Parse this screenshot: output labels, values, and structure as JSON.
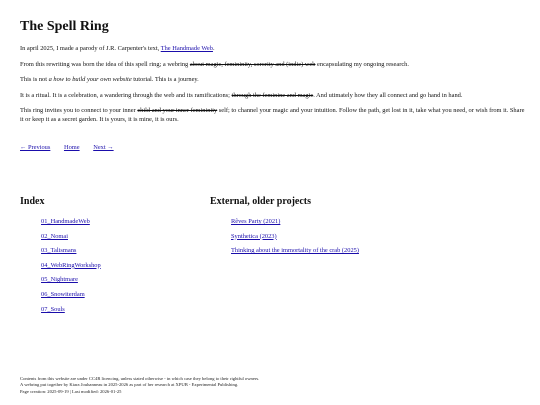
{
  "page": {
    "title": "The Spell Ring"
  },
  "intro": {
    "p1_text": "In april 2025, I made a parody of J.R. Carpenter's text, ",
    "p1_link": "The Handmade Web",
    "p1_end": ".",
    "p2_text": "From this rewriting was born the idea of this spell ring; a webring ",
    "p2_strike": "about magic, femininity, sorority and (indie) web",
    "p2_end": " encapsulating my ongoing research.",
    "p3_text": "This is not ",
    "p3_italic": "a how to build your own website",
    "p3_end": " tutorial. This is a journey.",
    "p4_text": "It is a ritual. It is a celebration, a wandering through the web and its ramifications; ",
    "p4_strike": "through the feminine and magic",
    "p4_end": ". And utimately how they all connect and go hand in hand.",
    "p5_text": "This ring invites you to connect to your inner ",
    "p5_strike": "child and your inner femininity",
    "p5_end": " self; to channel your magic and your intuition. Follow the path, get lost in it, take what you need, or wish from it. Share it or keep it as a secret garden. It is yours, it is mine, it is ours."
  },
  "nav": {
    "previous": "← Previous",
    "home": "Home",
    "next": "Next →"
  },
  "index": {
    "heading": "Index",
    "items": [
      "01_HandmadeWeb",
      "02_Nomai",
      "03_Talismans",
      "04_WebRingWorkshop",
      "05_Nightmare",
      "06_Snowiterdam",
      "07_Souls"
    ]
  },
  "external": {
    "heading": "External, older projects",
    "items": [
      "Rêves Party (2021)",
      "Synthetica (2023)",
      "Thinking about the immortality of the crab (2025)"
    ]
  },
  "footer": {
    "line1": "Contents from this website are under CC4R licencing, unless stated otherwise - in which case they belong to their rightful owners.",
    "line2": "A webring put together by Kiara Jouhanneau in 2025-2026 as part of her research at XPUB - Experimental Publishing.",
    "line3": "Page creation: 2025-09-19 | Last modified: 2026-01-25"
  }
}
